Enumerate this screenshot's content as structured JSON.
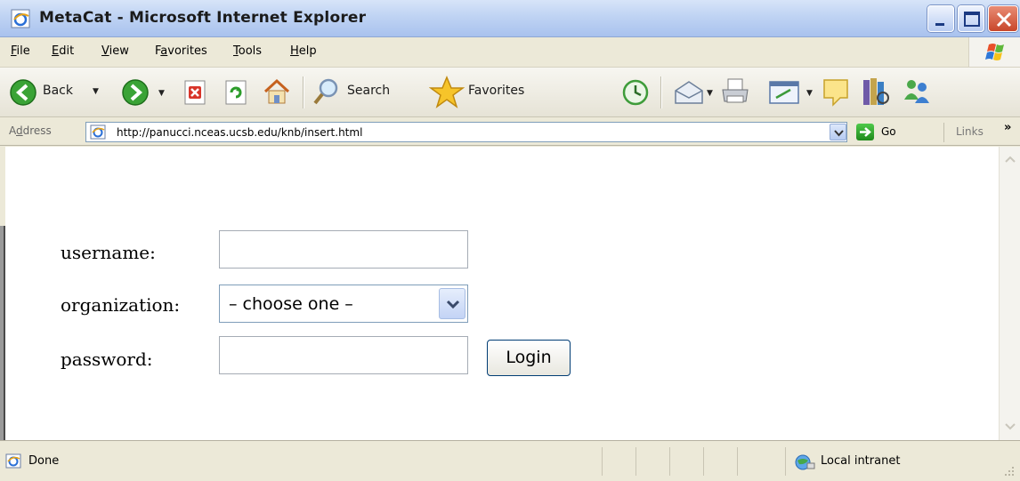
{
  "window": {
    "title": "MetaCat - Microsoft Internet Explorer"
  },
  "menu": [
    {
      "key": "F",
      "rest": "ile"
    },
    {
      "key": "E",
      "rest": "dit"
    },
    {
      "key": "V",
      "rest": "iew"
    },
    {
      "pre": "F",
      "key": "a",
      "rest": "vorites"
    },
    {
      "key": "T",
      "rest": "ools"
    },
    {
      "key": "H",
      "rest": "elp"
    }
  ],
  "toolbar": {
    "back_label": "Back",
    "search_label": "Search",
    "favorites_label": "Favorites"
  },
  "address": {
    "label_pre": "A",
    "label_key": "d",
    "label_rest": "dress",
    "url": "http://panucci.nceas.ucsb.edu/knb/insert.html",
    "go_label": "Go",
    "links_label": "Links",
    "links_more": "»"
  },
  "form": {
    "username_label": "username:",
    "organization_label": "organization:",
    "organization_value": "– choose one –",
    "password_label": "password:",
    "login_label": "Login"
  },
  "status": {
    "text": "Done",
    "zone": "Local intranet"
  },
  "colors": {
    "titlebar": "#bfd3f3",
    "chrome": "#ece9d8",
    "close": "#c8462a",
    "go": "#1f8a1b"
  }
}
